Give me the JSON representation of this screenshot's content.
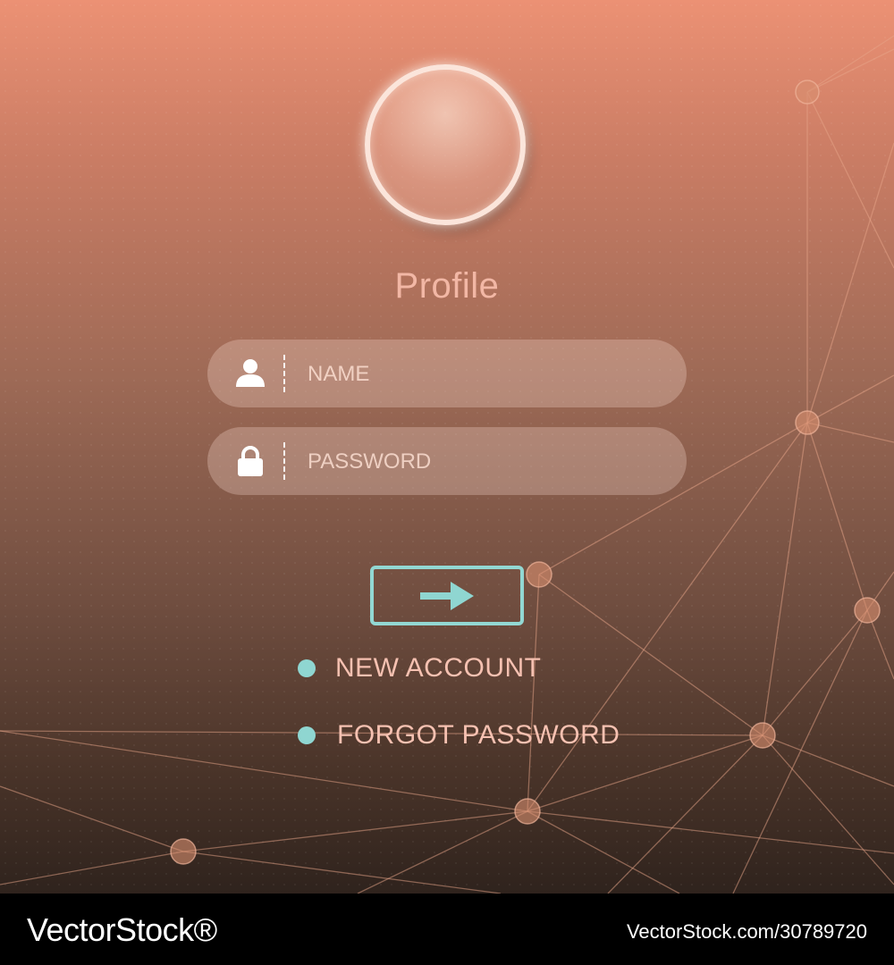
{
  "profile": {
    "title": "Profile"
  },
  "form": {
    "name_placeholder": "NAME",
    "password_placeholder": "PASSWORD",
    "submit_icon": "arrow-right-icon"
  },
  "links": {
    "new_account": "NEW ACCOUNT",
    "forgot_password": "FORGOT PASSWORD"
  },
  "icons": {
    "name_field": "user-icon",
    "password_field": "lock-icon"
  },
  "watermark": {
    "logo": "VectorStock®",
    "id": "VectorStock.com/30789720"
  },
  "colors": {
    "accent": "#8fd6d1",
    "text": "#f6c1b1",
    "background_top": "#ec9174",
    "background_bottom": "#2f231d"
  }
}
